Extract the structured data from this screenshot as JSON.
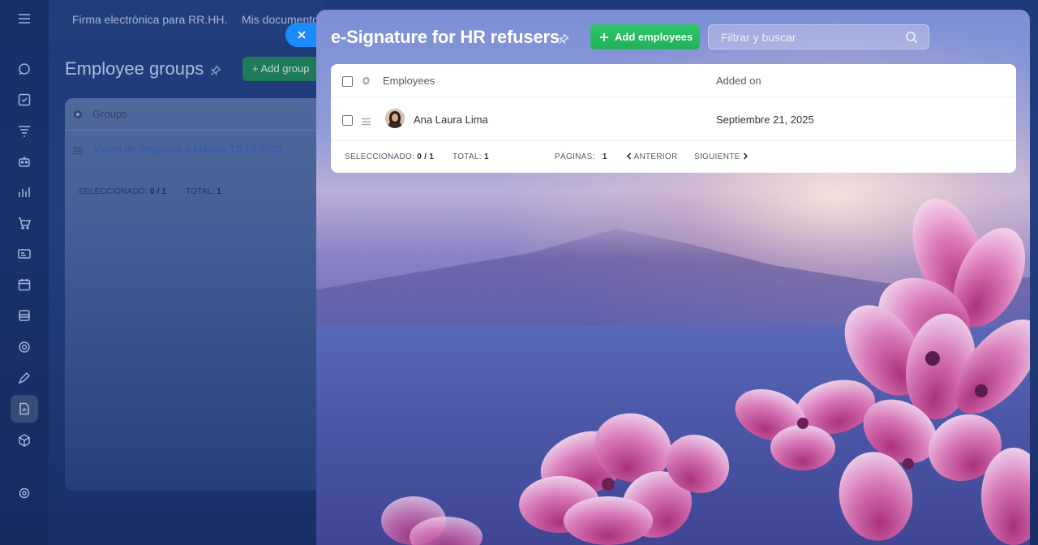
{
  "background": {
    "topnav": [
      "Firma electrónica para RR.HH.",
      "Mis documento"
    ],
    "page_title": "Employee groups",
    "add_group_label": "Add group",
    "grid_header": "Groups",
    "row_link": "Viajes de negocios a México 10.10.2025",
    "footer_selected_label": "SELECCIONADO:",
    "footer_selected_value": "0 / 1",
    "footer_total_label": "TOTAL:",
    "footer_total_value": "1"
  },
  "slider": {
    "title": "e-Signature for HR refusers",
    "add_button": "Add employees",
    "search_placeholder": "Filtrar y buscar",
    "columns": {
      "employees": "Employees",
      "added_on": "Added on"
    },
    "rows": [
      {
        "name": "Ana Laura Lima",
        "added_on": "Septiembre 21, 2025"
      }
    ],
    "footer": {
      "selected_label": "SELECCIONADO:",
      "selected_value": "0 / 1",
      "total_label": "TOTAL:",
      "total_value": "1",
      "pages_label": "PÁGINAS:",
      "pages_value": "1",
      "prev": "ANTERIOR",
      "next": "SIGUIENTE"
    }
  },
  "colors": {
    "accent_blue": "#1a8cff",
    "success_green": "#22c55e",
    "link_blue": "#2a5bbd"
  },
  "icons": [
    "menu-icon",
    "close-icon",
    "pin-icon",
    "plus-icon",
    "search-icon",
    "gear-icon",
    "drag-handle-icon",
    "chevron-left-icon",
    "chevron-right-icon"
  ]
}
